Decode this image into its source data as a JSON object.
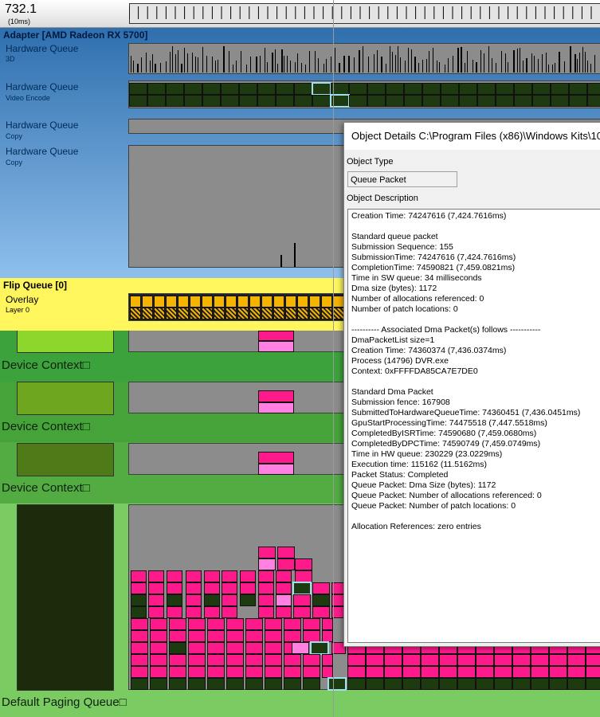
{
  "timeline": {
    "time": "732.1",
    "unit": "(10ms)"
  },
  "adapter": {
    "title": "Adapter [AMD Radeon RX 5700]"
  },
  "queues": [
    {
      "title": "Hardware Queue",
      "sub": "3D"
    },
    {
      "title": "Hardware Queue",
      "sub": "Video Encode"
    },
    {
      "title": "Hardware Queue",
      "sub": "Copy"
    },
    {
      "title": "Hardware Queue",
      "sub": "Copy"
    }
  ],
  "flip": {
    "title": "Flip Queue [0]",
    "overlay": "Overlay",
    "layer": "Layer 0"
  },
  "contexts": [
    "Device Context□",
    "Device Context□",
    "Device Context□"
  ],
  "paging": {
    "label": "Default Paging Queue□"
  },
  "colors": {
    "pink": "#ff1a8c",
    "light_pink": "#ff80e0",
    "dark_packet": "#1d3a10",
    "flip_yellow": "#fef65c",
    "selection": "#9fe0f0"
  },
  "dialog": {
    "title": "Object Details C:\\Program Files (x86)\\Windows Kits\\10",
    "type_label": "Object Type",
    "type_value": "Queue Packet",
    "desc_label": "Object Description",
    "description": "Creation Time: 74247616 (7,424.7616ms)\n\nStandard queue packet\nSubmission Sequence: 155\nSubmissionTime: 74247616 (7,424.7616ms)\nCompletionTime: 74590821 (7,459.0821ms)\nTime in SW queue: 34 milliseconds\nDma size (bytes): 1172\nNumber of allocations referenced: 0\nNumber of patch locations: 0\n\n---------- Associated Dma Packet(s) follows -----------\nDmaPacketList size=1\nCreation Time: 74360374 (7,436.0374ms)\nProcess (14796) DVR.exe\nContext: 0xFFFFDA85CA7E7DE0\n\nStandard Dma Packet\nSubmission fence: 167908\nSubmittedToHardwareQueueTime: 74360451 (7,436.0451ms)\nGpuStartProcessingTime: 74475518 (7,447.5518ms)\nCompletedByISRTime: 74590680 (7,459.0680ms)\nCompletedByDPCTime: 74590749 (7,459.0749ms)\nTime in HW queue: 230229 (23.0229ms)\nExecution time: 115162 (11.5162ms)\nPacket Status: Completed\nQueue Packet: Dma Size (bytes): 1172\nQueue Packet: Number of allocations referenced: 0\nQueue Packet: Number of patch locations: 0\n\nAllocation References: zero entries"
  }
}
